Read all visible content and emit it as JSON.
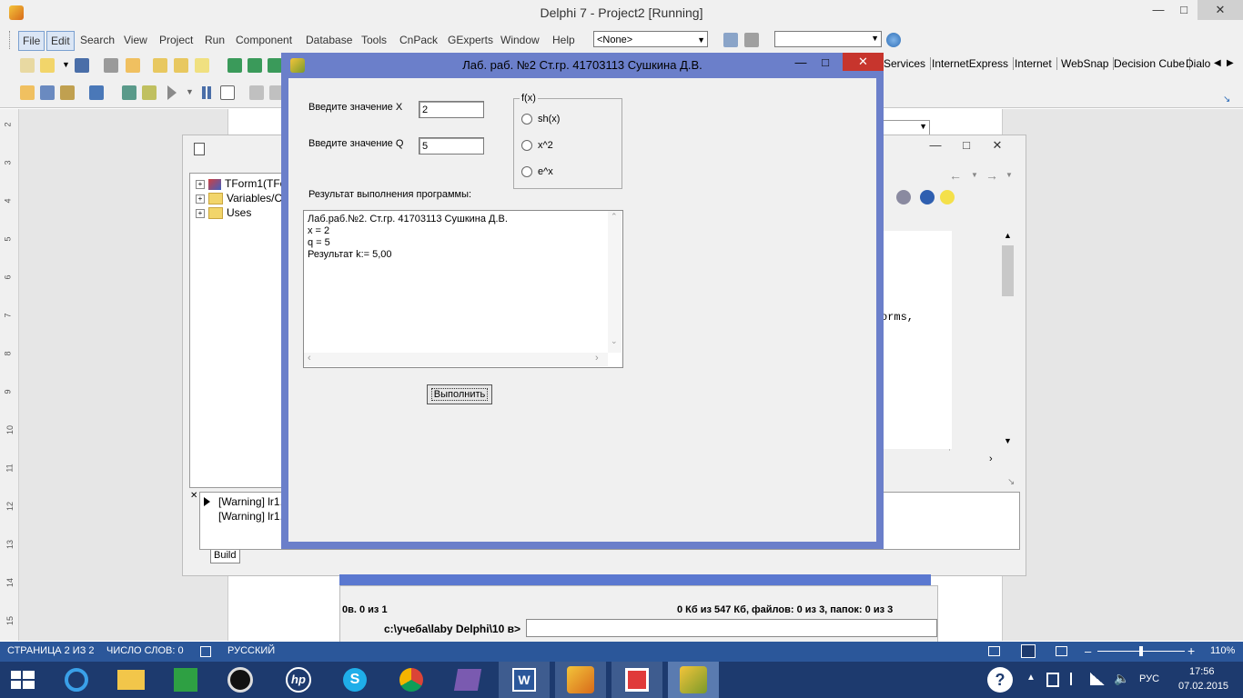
{
  "ide": {
    "title": "Delphi 7 - Project2 [Running]",
    "menu": [
      "File",
      "Edit",
      "Search",
      "View",
      "Project",
      "Run",
      "Component",
      "Database",
      "Tools",
      "CnPack",
      "GExperts",
      "Window",
      "Help"
    ],
    "combo_value": "<None>",
    "component_tabs": [
      "Services",
      "InternetExpress",
      "Internet",
      "WebSnap",
      "Decision Cube",
      "Dialo"
    ]
  },
  "editor": {
    "tree_items": [
      "TForm1(TFor",
      "Variables/Co",
      "Uses"
    ],
    "code_fragment": "orms,",
    "messages": [
      "[Warning] lr1.",
      "[Warning] lr1."
    ],
    "build_tab": "Build"
  },
  "filemanager": {
    "status_left": "0в. 0 из 1",
    "status_right": "0 Кб из 547 Кб, файлов: 0 из 3, папок: 0 из 3",
    "path_label": "c:\\учеба\\laby Delphi\\10 в>"
  },
  "form": {
    "title": "Лаб. раб. №2 Ст.гр.  41703113 Сушкина Д.В.",
    "x_label": "Введите значение X",
    "x_value": "2",
    "q_label": "Введите значение Q",
    "q_value": "5",
    "group_caption": "f(x)",
    "options": [
      "sh(x)",
      "x^2",
      "e^x"
    ],
    "result_label": "Результат выполнения программы:",
    "memo_lines": [
      "Лаб.раб.№2. Ст.гр.  41703113 Сушкина Д.В.",
      "x = 2",
      "q = 5",
      "Результат k:= 5,00"
    ],
    "run_button": "Выполнить"
  },
  "word_status": {
    "page": "СТРАНИЦА 2 ИЗ 2",
    "words": "ЧИСЛО СЛОВ: 0",
    "language": "РУССКИЙ",
    "zoom": "110%"
  },
  "taskbar": {
    "lang": "РУС",
    "time": "17:56",
    "date": "07.02.2015"
  },
  "ruler_numbers": [
    "2",
    "3",
    "4",
    "5",
    "6",
    "7",
    "8",
    "9",
    "10",
    "11",
    "12",
    "13",
    "14",
    "15"
  ],
  "colors": {
    "form_frame": "#6b7fca",
    "word_status": "#2b579a",
    "taskbar": "#1d3a6e",
    "close": "#c7352d"
  }
}
